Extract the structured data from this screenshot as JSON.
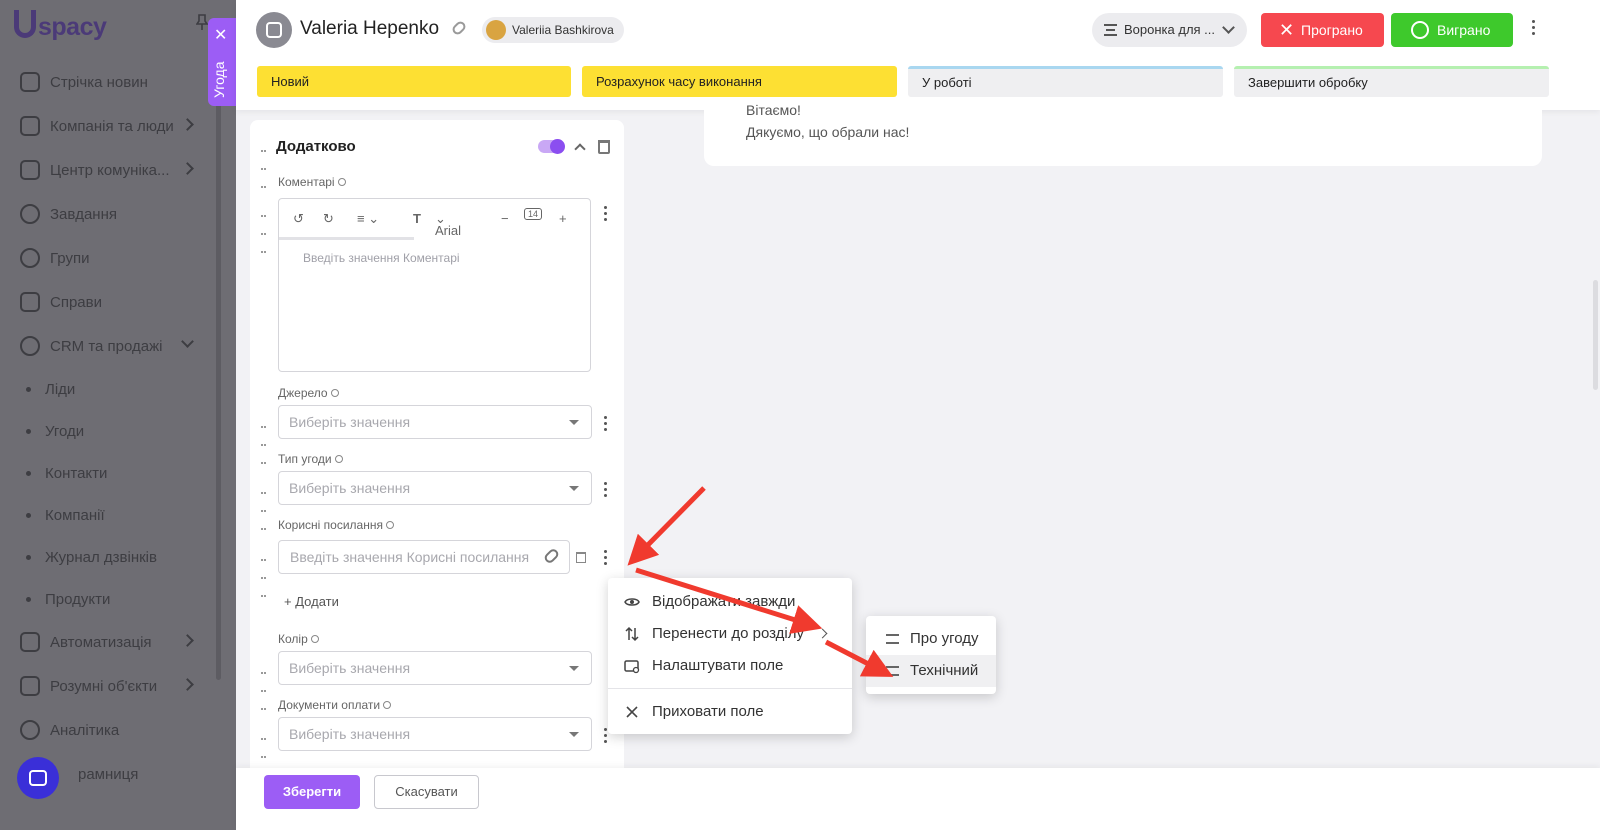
{
  "sidebar": {
    "logo": "spacy",
    "items": [
      {
        "label": "Стрічка новин"
      },
      {
        "label": "Компанія та люди"
      },
      {
        "label": "Центр комуніка..."
      },
      {
        "label": "Завдання"
      },
      {
        "label": "Групи"
      },
      {
        "label": "Справи"
      },
      {
        "label": "CRM та продажі"
      }
    ],
    "crm_sub": [
      {
        "label": "Ліди"
      },
      {
        "label": "Угоди"
      },
      {
        "label": "Контакти"
      },
      {
        "label": "Компанії"
      },
      {
        "label": "Журнал дзвінків"
      },
      {
        "label": "Продукти"
      }
    ],
    "items2": [
      {
        "label": "Автоматизація"
      },
      {
        "label": "Розумні об'єкти"
      },
      {
        "label": "Аналітика"
      },
      {
        "label": "рамниця"
      }
    ]
  },
  "deal_tab": {
    "label": "Угода",
    "close": "✕"
  },
  "header": {
    "deal_name": "Valeria Hepenko",
    "owner": "Valeriia Bashkirova",
    "funnel": "Воронка для ...",
    "lost_label": "Програно",
    "won_label": "Виграно",
    "stages": [
      {
        "label": "Новий"
      },
      {
        "label": "Розрахунок часу виконання"
      },
      {
        "label": "У роботі"
      },
      {
        "label": "Завершити обробку"
      }
    ]
  },
  "message": {
    "line1": "Вітаємо!",
    "line2": "Дякуємо, що обрали нас!"
  },
  "section": {
    "title": "Додатково",
    "comments_label": "Коментарі",
    "comments_placeholder": "Введіть значення Коментарі",
    "editor_font": "Arial",
    "editor_font_size": "14",
    "source_label": "Джерело",
    "source_placeholder": "Виберіть значення",
    "deal_type_label": "Тип угоди",
    "deal_type_placeholder": "Виберіть значення",
    "links_label": "Корисні посилання",
    "links_placeholder": "Введіть значення Корисні посилання",
    "add_label": "Додати",
    "color_label": "Колір",
    "color_placeholder": "Виберіть значення",
    "payment_docs_label": "Документи оплати",
    "payment_docs_placeholder": "Виберіть значення"
  },
  "context_menu": {
    "items": [
      {
        "label": "Відображати завжди",
        "icon": "eye-icon"
      },
      {
        "label": "Перенести до розділу",
        "icon": "swap-vertical-icon"
      },
      {
        "label": "Налаштувати поле",
        "icon": "settings-field-icon"
      },
      {
        "label": "Приховати поле",
        "icon": "close-icon"
      }
    ]
  },
  "submenu": {
    "items": [
      {
        "label": "Про угоду"
      },
      {
        "label": "Технічний"
      }
    ]
  },
  "footer": {
    "save_label": "Зберегти",
    "cancel_label": "Скасувати"
  },
  "colors": {
    "accent": "#9c5df5",
    "lost": "#f6484f",
    "won": "#3ec92c",
    "stage_active": "#fde033",
    "annotation_arrow": "#f03a2e"
  }
}
